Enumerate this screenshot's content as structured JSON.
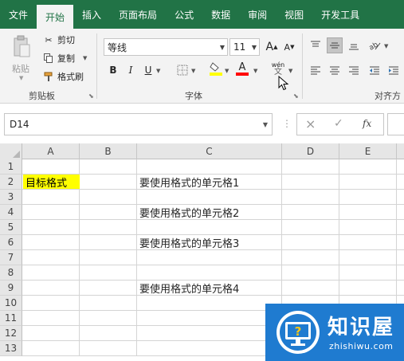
{
  "menu": {
    "tabs": [
      "文件",
      "开始",
      "插入",
      "页面布局",
      "公式",
      "数据",
      "审阅",
      "视图",
      "开发工具"
    ],
    "active_index": 1
  },
  "ribbon": {
    "clipboard": {
      "paste_label": "粘贴",
      "cut_label": "剪切",
      "copy_label": "复制",
      "format_painter_label": "格式刷",
      "group_label": "剪贴板"
    },
    "font": {
      "font_name": "等线",
      "font_size": "11",
      "grow_label": "A",
      "shrink_label": "A",
      "bold_label": "B",
      "italic_label": "I",
      "underline_label": "U",
      "font_color_label": "A",
      "phonetic_label": "wén",
      "group_label": "字体"
    },
    "alignment": {
      "group_label": "对齐方"
    }
  },
  "formula_bar": {
    "name_box": "D14",
    "cancel_icon": "×",
    "enter_icon": "✓",
    "fx_label": "fx"
  },
  "sheet": {
    "columns": [
      "A",
      "B",
      "C",
      "D",
      "E"
    ],
    "rows": [
      "1",
      "2",
      "3",
      "4",
      "5",
      "6",
      "7",
      "8",
      "9",
      "10",
      "11",
      "12",
      "13"
    ],
    "cells": {
      "A2": "目标格式",
      "C2": "要使用格式的单元格1",
      "C4": "要使用格式的单元格2",
      "C6": "要使用格式的单元格3",
      "C9": "要使用格式的单元格4"
    },
    "highlight_color": "#ffff00"
  },
  "watermark": {
    "title": "知识屋",
    "subtitle": "zhishiwu.com"
  },
  "colors": {
    "brand": "#217346",
    "watermark_bg": "#1f7bd0"
  }
}
